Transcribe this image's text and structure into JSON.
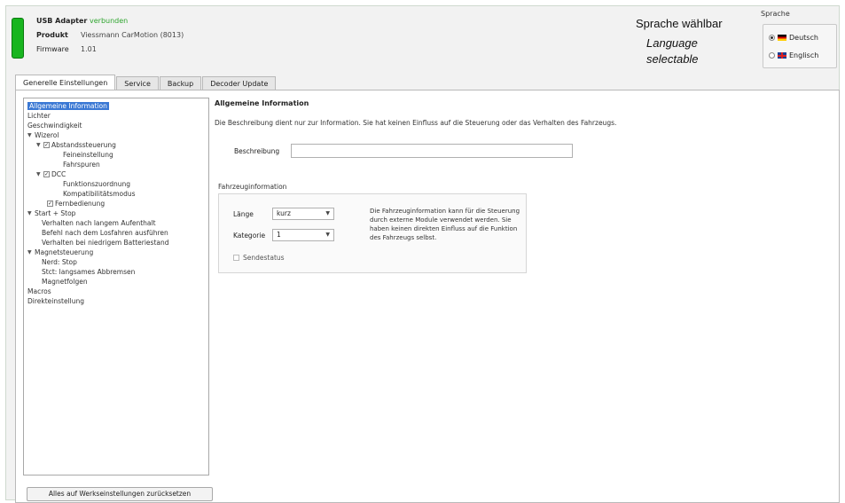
{
  "header": {
    "adapter_label": "USB Adapter",
    "adapter_status": "verbunden",
    "product_label": "Produkt",
    "product_value": "Viessmann CarMotion (8013)",
    "firmware_label": "Firmware",
    "firmware_value": "1.01",
    "status_color": "#18b51f"
  },
  "annotations": {
    "german": "Sprache wählbar",
    "english_line1": "Language",
    "english_line2": "selectable"
  },
  "language": {
    "title": "Sprache",
    "options": [
      {
        "label": "Deutsch",
        "selected": true,
        "icon": "flag-de-icon"
      },
      {
        "label": "Englisch",
        "selected": false,
        "icon": "flag-gb-icon"
      }
    ]
  },
  "tabs": [
    {
      "label": "Generelle Einstellungen",
      "active": true
    },
    {
      "label": "Service",
      "active": false
    },
    {
      "label": "Backup",
      "active": false
    },
    {
      "label": "Decoder Update",
      "active": false
    }
  ],
  "tree": [
    {
      "label": "Allgemeine Information",
      "selected": true
    },
    {
      "label": "Lichter"
    },
    {
      "label": "Geschwindigkeit"
    },
    {
      "label": "Wizerol"
    },
    {
      "label": "Abstandssteuerung"
    },
    {
      "label": "Feineinstellung"
    },
    {
      "label": "Fahrspuren"
    },
    {
      "label": "DCC"
    },
    {
      "label": "Funktionszuordnung"
    },
    {
      "label": "Kompatibilitätsmodus"
    },
    {
      "label": "Fernbedienung"
    },
    {
      "label": "Start + Stop"
    },
    {
      "label": "Verhalten nach langem Aufenthalt"
    },
    {
      "label": "Befehl nach dem Losfahren ausführen"
    },
    {
      "label": "Verhalten bei niedrigem Batteriestand"
    },
    {
      "label": "Magnetsteuerung"
    },
    {
      "label": "Nerd: Stop"
    },
    {
      "label": "Stct: langsames Abbremsen"
    },
    {
      "label": "Magnetfolgen"
    },
    {
      "label": "Macros"
    },
    {
      "label": "Direkteinstellung"
    }
  ],
  "reset_button": "Alles auf Werkseinstellungen zurücksetzen",
  "content": {
    "title": "Allgemeine Information",
    "description": "Die Beschreibung dient nur zur Information. Sie hat keinen Einfluss auf die Steuerung oder das Verhalten des Fahrzeugs.",
    "field_label": "Beschreibung",
    "field_value": "",
    "group_title": "Fahrzeuginformation",
    "length_label": "Länge",
    "length_value": "kurz",
    "category_label": "Kategorie",
    "category_value": "1",
    "sender_label": "Sendestatus",
    "info": "Die Fahrzeuginformation kann für die Steuerung durch externe Module verwendet werden. Sie haben keinen direkten Einfluss auf die Funktion des Fahrzeugs selbst."
  }
}
